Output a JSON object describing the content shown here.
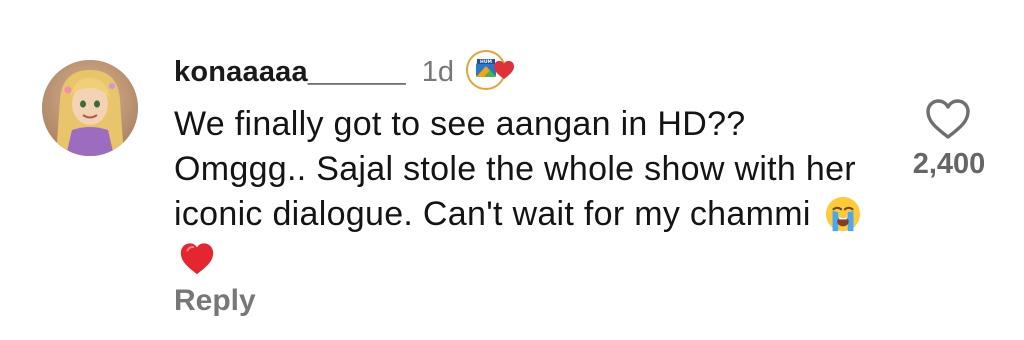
{
  "comment": {
    "username": "konaaaaa______",
    "timestamp": "1d",
    "badge_icon": "hum-tv-logo-icon",
    "badge_text": "HUM",
    "badge_heart_color": "#e0313a",
    "text_main": "We finally got to see aangan in HD?? Omggg.. Sajal stole the whole show with her iconic dialogue. Can't wait for my chammi",
    "emojis": [
      "loudly-crying-face-icon",
      "red-heart-icon"
    ],
    "reply_label": "Reply",
    "like_count": "2,400",
    "like_icon": "heart-outline-icon"
  }
}
